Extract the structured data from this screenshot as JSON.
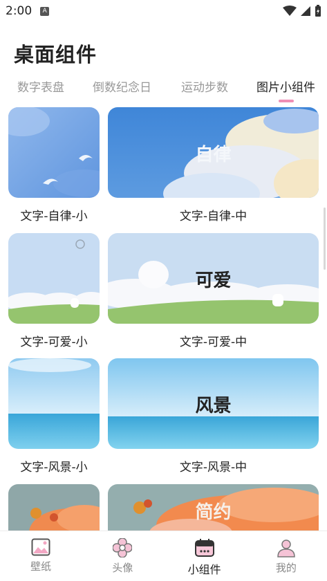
{
  "status": {
    "time": "2:00",
    "badge": "A"
  },
  "page_title": "桌面组件",
  "tabs": [
    {
      "label": "数字表盘"
    },
    {
      "label": "倒数纪念日"
    },
    {
      "label": "运动步数"
    },
    {
      "label": "图片小组件",
      "active": true
    }
  ],
  "widgets": [
    {
      "small_caption": "文字-自律-小",
      "medium_caption": "文字-自律-中",
      "medium_text": "自律"
    },
    {
      "small_caption": "文字-可爱-小",
      "medium_caption": "文字-可爱-中",
      "medium_text": "可爱"
    },
    {
      "small_caption": "文字-风景-小",
      "medium_caption": "文字-风景-中",
      "medium_text": "风景"
    },
    {
      "medium_text": "简约"
    }
  ],
  "bottom_nav": [
    {
      "label": "壁纸",
      "icon": "picture-icon"
    },
    {
      "label": "头像",
      "icon": "avatar-flower-icon"
    },
    {
      "label": "小组件",
      "icon": "widget-calendar-icon",
      "active": true
    },
    {
      "label": "我的",
      "icon": "user-icon"
    }
  ],
  "colors": {
    "accent": "#ef8fb5",
    "sky_blue": "#4a8fdc",
    "sea_blue": "#3aa6d8",
    "grass": "#8fc36a"
  }
}
